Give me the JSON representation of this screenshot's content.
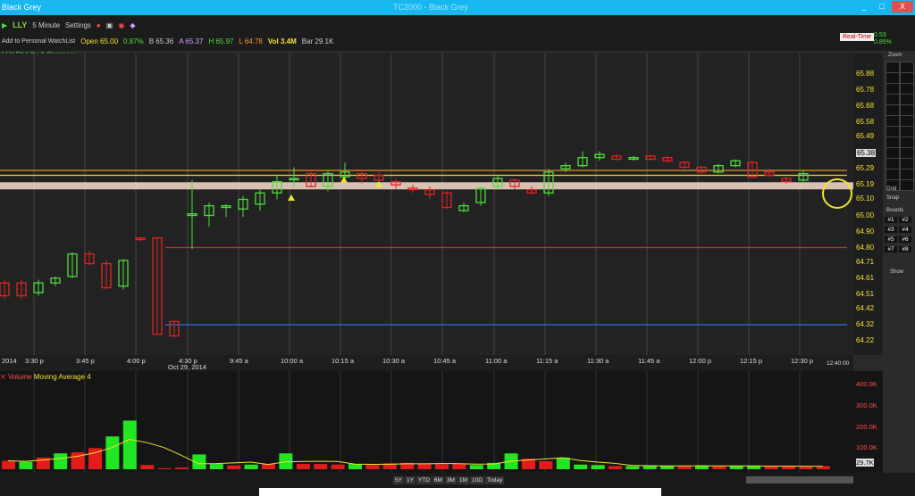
{
  "window": {
    "title": "TC2000 - Black Grey",
    "menu": "Black Grey",
    "buttons": [
      "_",
      "□",
      "X"
    ]
  },
  "toolbar": {
    "symbol": "LLY",
    "timeframe": "5 Minute",
    "settings_label": "Settings",
    "watchlist": "Add to Personal WatchList",
    "open": "Open 65.00",
    "change_top": "0.53",
    "change_pct": "0.87%",
    "bid": "B 65.36",
    "ask": "A 65.37",
    "high": "H 65.97",
    "low": "L 64.78",
    "volume": "Vol 3.4M",
    "bar": "Bar 29.1K",
    "realtime": "Real-Time",
    "right_change": "0.53",
    "right_pct": "0.85%"
  },
  "panel_label": "LLY Eli Lilly & Company",
  "colors": {
    "up": "#4ddd3b",
    "down": "#e32222",
    "accent": "#18b7f0",
    "price_label": "#f2e230"
  },
  "price_axis": [
    "65.88",
    "65.78",
    "65.68",
    "65.58",
    "65.49",
    "65.39",
    "65.29",
    "65.19",
    "65.10",
    "65.00",
    "64.90",
    "64.80",
    "64.71",
    "64.61",
    "64.51",
    "64.42",
    "64.32",
    "64.22"
  ],
  "last_price": "65.38",
  "x_labels": [
    "3:30 p",
    "3:45 p",
    "4:00 p",
    "4:30 p",
    "9:45 a",
    "10:00 a",
    "10:15 a",
    "10:30 a",
    "10:45 a",
    "11:00 a",
    "11:15 a",
    "11:30 a",
    "11:45 a",
    "12:00 p",
    "12:15 p",
    "12:30 p"
  ],
  "date_labels": {
    "left": "2014",
    "mid": "Oct 29, 2014",
    "clock": "12:40:00"
  },
  "volume_header": {
    "label": "Volume",
    "ma": "Moving Average 4"
  },
  "volume_axis": [
    "400.0K",
    "300.0K",
    "200.0K",
    "100.0K"
  ],
  "volume_last": "29.7K",
  "range_buttons": [
    "5Y",
    "1Y",
    "YTD",
    "6M",
    "3M",
    "1M",
    "10D",
    "Today"
  ],
  "right_panel": {
    "zoom": "Zoom",
    "boards": "Boards",
    "boards_items": [
      "#1",
      "#2",
      "#3",
      "#4",
      "#5",
      "#6",
      "#7",
      "#8"
    ],
    "grid": "Grid",
    "snap": "Snap",
    "show": "Show"
  },
  "chart_data": {
    "type": "candlestick",
    "ylim": [
      64.22,
      65.88
    ],
    "candles": [
      {
        "o": 64.58,
        "c": 64.5,
        "h": 64.6,
        "l": 64.48
      },
      {
        "o": 64.58,
        "c": 64.5,
        "h": 64.6,
        "l": 64.48
      },
      {
        "o": 64.52,
        "c": 64.58,
        "h": 64.6,
        "l": 64.5
      },
      {
        "o": 64.58,
        "c": 64.61,
        "h": 64.62,
        "l": 64.56
      },
      {
        "o": 64.62,
        "c": 64.76,
        "h": 64.77,
        "l": 64.61
      },
      {
        "o": 64.76,
        "c": 64.7,
        "h": 64.78,
        "l": 64.69
      },
      {
        "o": 64.7,
        "c": 64.55,
        "h": 64.72,
        "l": 64.54
      },
      {
        "o": 64.56,
        "c": 64.72,
        "h": 64.73,
        "l": 64.54
      },
      {
        "o": 64.86,
        "c": 64.85,
        "h": 64.86,
        "l": 64.84
      },
      {
        "o": 64.86,
        "c": 64.26,
        "h": 64.86,
        "l": 64.26
      },
      {
        "o": 64.34,
        "c": 64.25,
        "h": 64.34,
        "l": 64.25
      },
      {
        "o": 65.0,
        "c": 65.01,
        "h": 65.22,
        "l": 64.79
      },
      {
        "o": 65.0,
        "c": 65.06,
        "h": 65.08,
        "l": 64.93
      },
      {
        "o": 65.05,
        "c": 65.06,
        "h": 65.07,
        "l": 64.99
      },
      {
        "o": 65.04,
        "c": 65.1,
        "h": 65.12,
        "l": 64.99
      },
      {
        "o": 65.07,
        "c": 65.14,
        "h": 65.16,
        "l": 65.03
      },
      {
        "o": 65.14,
        "c": 65.21,
        "h": 65.25,
        "l": 65.1
      },
      {
        "o": 65.23,
        "c": 65.23,
        "h": 65.3,
        "l": 65.18
      },
      {
        "o": 65.26,
        "c": 65.18,
        "h": 65.27,
        "l": 65.18
      },
      {
        "o": 65.18,
        "c": 65.26,
        "h": 65.28,
        "l": 65.15
      },
      {
        "o": 65.24,
        "c": 65.27,
        "h": 65.33,
        "l": 65.22
      },
      {
        "o": 65.26,
        "c": 65.23,
        "h": 65.27,
        "l": 65.2
      },
      {
        "o": 65.25,
        "c": 65.22,
        "h": 65.27,
        "l": 65.19
      },
      {
        "o": 65.21,
        "c": 65.19,
        "h": 65.23,
        "l": 65.16
      },
      {
        "o": 65.17,
        "c": 65.16,
        "h": 65.19,
        "l": 65.14
      },
      {
        "o": 65.16,
        "c": 65.13,
        "h": 65.18,
        "l": 65.1
      },
      {
        "o": 65.14,
        "c": 65.05,
        "h": 65.15,
        "l": 65.04
      },
      {
        "o": 65.03,
        "c": 65.06,
        "h": 65.08,
        "l": 65.02
      },
      {
        "o": 65.08,
        "c": 65.17,
        "h": 65.18,
        "l": 65.06
      },
      {
        "o": 65.18,
        "c": 65.23,
        "h": 65.25,
        "l": 65.16
      },
      {
        "o": 65.22,
        "c": 65.18,
        "h": 65.23,
        "l": 65.16
      },
      {
        "o": 65.16,
        "c": 65.14,
        "h": 65.18,
        "l": 65.13
      },
      {
        "o": 65.14,
        "c": 65.27,
        "h": 65.29,
        "l": 65.12
      },
      {
        "o": 65.29,
        "c": 65.31,
        "h": 65.33,
        "l": 65.27
      },
      {
        "o": 65.31,
        "c": 65.36,
        "h": 65.4,
        "l": 65.3
      },
      {
        "o": 65.36,
        "c": 65.38,
        "h": 65.4,
        "l": 65.34
      },
      {
        "o": 65.37,
        "c": 65.35,
        "h": 65.38,
        "l": 65.34
      },
      {
        "o": 65.35,
        "c": 65.36,
        "h": 65.37,
        "l": 65.34
      },
      {
        "o": 65.37,
        "c": 65.35,
        "h": 65.38,
        "l": 65.34
      },
      {
        "o": 65.36,
        "c": 65.34,
        "h": 65.37,
        "l": 65.33
      },
      {
        "o": 65.33,
        "c": 65.3,
        "h": 65.34,
        "l": 65.29
      },
      {
        "o": 65.3,
        "c": 65.27,
        "h": 65.31,
        "l": 65.26
      },
      {
        "o": 65.27,
        "c": 65.31,
        "h": 65.32,
        "l": 65.26
      },
      {
        "o": 65.31,
        "c": 65.34,
        "h": 65.35,
        "l": 65.3
      },
      {
        "o": 65.33,
        "c": 65.24,
        "h": 65.34,
        "l": 65.23
      },
      {
        "o": 65.27,
        "c": 65.25,
        "h": 65.29,
        "l": 65.24
      },
      {
        "o": 65.23,
        "c": 65.21,
        "h": 65.24,
        "l": 65.2
      },
      {
        "o": 65.22,
        "c": 65.26,
        "h": 65.28,
        "l": 65.2
      }
    ],
    "levels": [
      {
        "price": 65.28,
        "color": "#f39a2b"
      },
      {
        "price": 65.25,
        "color": "#f3d12b"
      },
      {
        "price": 64.8,
        "color": "#e32222"
      },
      {
        "price": 64.32,
        "color": "#2f6ef0"
      }
    ],
    "volume": [
      {
        "v": 40,
        "up": false
      },
      {
        "v": 35,
        "up": true
      },
      {
        "v": 55,
        "up": false
      },
      {
        "v": 75,
        "up": true
      },
      {
        "v": 80,
        "up": false
      },
      {
        "v": 100,
        "up": false
      },
      {
        "v": 155,
        "up": true
      },
      {
        "v": 230,
        "up": true
      },
      {
        "v": 20,
        "up": false
      },
      {
        "v": 5,
        "up": false
      },
      {
        "v": 8,
        "up": false
      },
      {
        "v": 70,
        "up": true
      },
      {
        "v": 25,
        "up": true
      },
      {
        "v": 18,
        "up": false
      },
      {
        "v": 22,
        "up": true
      },
      {
        "v": 25,
        "up": false
      },
      {
        "v": 75,
        "up": true
      },
      {
        "v": 25,
        "up": false
      },
      {
        "v": 25,
        "up": false
      },
      {
        "v": 22,
        "up": false
      },
      {
        "v": 25,
        "up": true
      },
      {
        "v": 20,
        "up": false
      },
      {
        "v": 28,
        "up": false
      },
      {
        "v": 30,
        "up": false
      },
      {
        "v": 26,
        "up": false
      },
      {
        "v": 24,
        "up": false
      },
      {
        "v": 26,
        "up": false
      },
      {
        "v": 20,
        "up": true
      },
      {
        "v": 30,
        "up": true
      },
      {
        "v": 75,
        "up": true
      },
      {
        "v": 50,
        "up": false
      },
      {
        "v": 38,
        "up": false
      },
      {
        "v": 55,
        "up": true
      },
      {
        "v": 22,
        "up": true
      },
      {
        "v": 20,
        "up": true
      },
      {
        "v": 15,
        "up": false
      },
      {
        "v": 15,
        "up": true
      },
      {
        "v": 18,
        "up": true
      },
      {
        "v": 15,
        "up": true
      },
      {
        "v": 15,
        "up": false
      },
      {
        "v": 18,
        "up": true
      },
      {
        "v": 15,
        "up": false
      },
      {
        "v": 15,
        "up": true
      },
      {
        "v": 15,
        "up": true
      },
      {
        "v": 15,
        "up": false
      },
      {
        "v": 15,
        "up": false
      },
      {
        "v": 12,
        "up": false
      },
      {
        "v": 15,
        "up": false
      }
    ],
    "vol_ylim": [
      0,
      430
    ]
  }
}
